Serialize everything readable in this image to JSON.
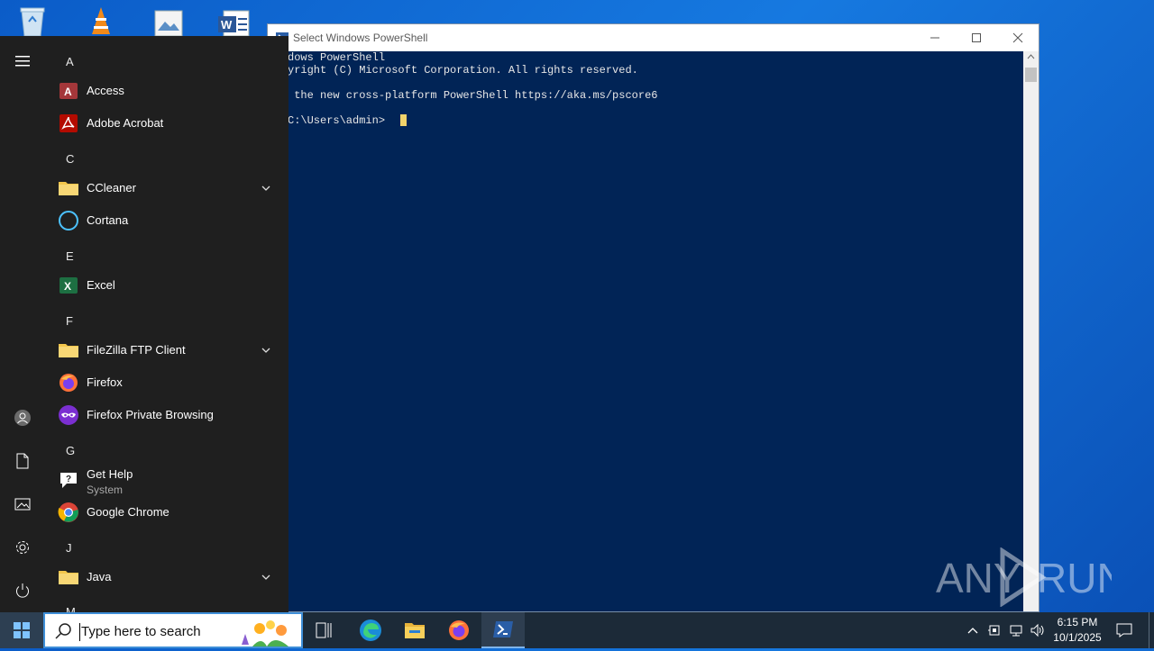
{
  "desktop": {
    "icons": [
      "recycle-bin-icon",
      "vlc-icon",
      "image-file-icon",
      "word-document-icon"
    ]
  },
  "powershell": {
    "title": "Select Windows PowerShell",
    "lines": [
      "dows PowerShell",
      "yright (C) Microsoft Corporation. All rights reserved.",
      "",
      " the new cross-platform PowerShell https://aka.ms/pscore6",
      "",
      "C:\\Users\\admin> "
    ],
    "bg": "#012456"
  },
  "start_menu": {
    "sections": [
      {
        "letter": "A",
        "apps": [
          {
            "name": "Access",
            "icon": "access-icon"
          },
          {
            "name": "Adobe Acrobat",
            "icon": "acrobat-icon"
          }
        ]
      },
      {
        "letter": "C",
        "apps": [
          {
            "name": "CCleaner",
            "icon": "folder-icon",
            "expandable": true
          },
          {
            "name": "Cortana",
            "icon": "cortana-icon"
          }
        ]
      },
      {
        "letter": "E",
        "apps": [
          {
            "name": "Excel",
            "icon": "excel-icon"
          }
        ]
      },
      {
        "letter": "F",
        "apps": [
          {
            "name": "FileZilla FTP Client",
            "icon": "folder-icon",
            "expandable": true
          },
          {
            "name": "Firefox",
            "icon": "firefox-icon"
          },
          {
            "name": "Firefox Private Browsing",
            "icon": "firefox-private-icon"
          }
        ]
      },
      {
        "letter": "G",
        "apps": [
          {
            "name": "Get Help",
            "sub": "System",
            "icon": "get-help-icon"
          },
          {
            "name": "Google Chrome",
            "icon": "chrome-icon"
          }
        ]
      },
      {
        "letter": "J",
        "apps": [
          {
            "name": "Java",
            "icon": "folder-icon",
            "expandable": true
          }
        ]
      },
      {
        "letter": "M",
        "apps": []
      }
    ],
    "rail": [
      "hamburger-icon",
      "user-icon",
      "documents-icon",
      "pictures-icon",
      "settings-icon",
      "power-icon"
    ]
  },
  "taskbar": {
    "search_placeholder": "Type here to search",
    "apps": [
      "task-view-icon",
      "edge-icon",
      "file-explorer-icon",
      "firefox-icon",
      "powershell-icon"
    ],
    "clock": {
      "time": "6:15 PM",
      "date": "10/1/2025"
    }
  },
  "watermark": {
    "left": "ANY",
    "right": "RUN"
  }
}
